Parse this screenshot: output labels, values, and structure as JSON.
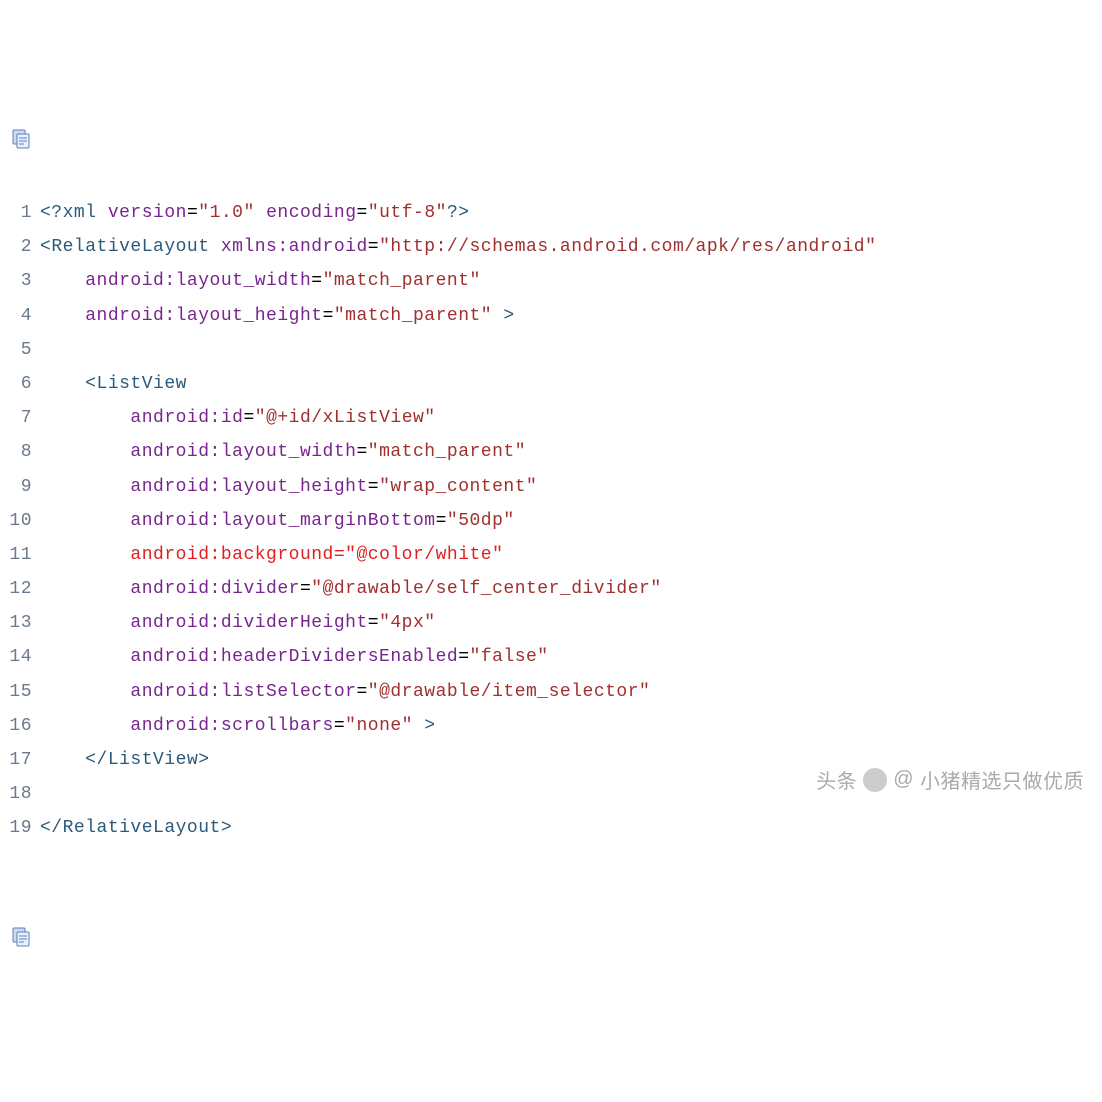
{
  "toolbar": {
    "copy_icon_color": "#5a7fbf",
    "copy_icon_color2": "#8fa8d8"
  },
  "code": {
    "lines": [
      {
        "n": "1",
        "segs": [
          {
            "t": "<?",
            "c": "c-prolog"
          },
          {
            "t": "xml ",
            "c": "c-prolog"
          },
          {
            "t": "version",
            "c": "c-attr"
          },
          {
            "t": "=",
            "c": "c-eq"
          },
          {
            "t": "\"1.0\"",
            "c": "c-str"
          },
          {
            "t": " ",
            "c": "c-plain"
          },
          {
            "t": "encoding",
            "c": "c-attr"
          },
          {
            "t": "=",
            "c": "c-eq"
          },
          {
            "t": "\"utf-8\"",
            "c": "c-str"
          },
          {
            "t": "?>",
            "c": "c-prolog"
          }
        ]
      },
      {
        "n": "2",
        "segs": [
          {
            "t": "<",
            "c": "c-punc"
          },
          {
            "t": "RelativeLayout ",
            "c": "c-tag"
          },
          {
            "t": "xmlns:android",
            "c": "c-attr"
          },
          {
            "t": "=",
            "c": "c-eq"
          },
          {
            "t": "\"http://schemas.android.com/apk/res/android\"",
            "c": "c-str"
          }
        ]
      },
      {
        "n": "3",
        "segs": [
          {
            "t": "    ",
            "c": "c-plain"
          },
          {
            "t": "android:layout_width",
            "c": "c-attr"
          },
          {
            "t": "=",
            "c": "c-eq"
          },
          {
            "t": "\"match_parent\"",
            "c": "c-str"
          }
        ]
      },
      {
        "n": "4",
        "segs": [
          {
            "t": "    ",
            "c": "c-plain"
          },
          {
            "t": "android:layout_height",
            "c": "c-attr"
          },
          {
            "t": "=",
            "c": "c-eq"
          },
          {
            "t": "\"match_parent\"",
            "c": "c-str"
          },
          {
            "t": " >",
            "c": "c-gt"
          }
        ]
      },
      {
        "n": "5",
        "segs": [
          {
            "t": "",
            "c": "c-plain"
          }
        ]
      },
      {
        "n": "6",
        "segs": [
          {
            "t": "    ",
            "c": "c-plain"
          },
          {
            "t": "<",
            "c": "c-punc"
          },
          {
            "t": "ListView",
            "c": "c-tag"
          }
        ]
      },
      {
        "n": "7",
        "segs": [
          {
            "t": "        ",
            "c": "c-plain"
          },
          {
            "t": "android:id",
            "c": "c-attr"
          },
          {
            "t": "=",
            "c": "c-eq"
          },
          {
            "t": "\"@+id/xListView\"",
            "c": "c-str"
          }
        ]
      },
      {
        "n": "8",
        "segs": [
          {
            "t": "        ",
            "c": "c-plain"
          },
          {
            "t": "android:layout_width",
            "c": "c-attr"
          },
          {
            "t": "=",
            "c": "c-eq"
          },
          {
            "t": "\"match_parent\"",
            "c": "c-str"
          }
        ]
      },
      {
        "n": "9",
        "segs": [
          {
            "t": "        ",
            "c": "c-plain"
          },
          {
            "t": "android:layout_height",
            "c": "c-attr"
          },
          {
            "t": "=",
            "c": "c-eq"
          },
          {
            "t": "\"wrap_content\"",
            "c": "c-str"
          }
        ]
      },
      {
        "n": "10",
        "segs": [
          {
            "t": "        ",
            "c": "c-plain"
          },
          {
            "t": "android:layout_marginBottom",
            "c": "c-attr"
          },
          {
            "t": "=",
            "c": "c-eq"
          },
          {
            "t": "\"50dp\"",
            "c": "c-str"
          }
        ]
      },
      {
        "n": "11",
        "segs": [
          {
            "t": "        ",
            "c": "c-plain"
          },
          {
            "t": "android:background",
            "c": "c-err"
          },
          {
            "t": "=",
            "c": "c-err"
          },
          {
            "t": "\"@color/white\"",
            "c": "c-err"
          }
        ]
      },
      {
        "n": "12",
        "segs": [
          {
            "t": "        ",
            "c": "c-plain"
          },
          {
            "t": "android:divider",
            "c": "c-attr"
          },
          {
            "t": "=",
            "c": "c-eq"
          },
          {
            "t": "\"@drawable/self_center_divider\"",
            "c": "c-str"
          }
        ]
      },
      {
        "n": "13",
        "segs": [
          {
            "t": "        ",
            "c": "c-plain"
          },
          {
            "t": "android:dividerHeight",
            "c": "c-attr"
          },
          {
            "t": "=",
            "c": "c-eq"
          },
          {
            "t": "\"4px\"",
            "c": "c-str"
          }
        ]
      },
      {
        "n": "14",
        "segs": [
          {
            "t": "        ",
            "c": "c-plain"
          },
          {
            "t": "android:headerDividersEnabled",
            "c": "c-attr"
          },
          {
            "t": "=",
            "c": "c-eq"
          },
          {
            "t": "\"false\"",
            "c": "c-str"
          }
        ]
      },
      {
        "n": "15",
        "segs": [
          {
            "t": "        ",
            "c": "c-plain"
          },
          {
            "t": "android:listSelector",
            "c": "c-attr"
          },
          {
            "t": "=",
            "c": "c-eq"
          },
          {
            "t": "\"@drawable/item_selector\"",
            "c": "c-str"
          }
        ]
      },
      {
        "n": "16",
        "segs": [
          {
            "t": "        ",
            "c": "c-plain"
          },
          {
            "t": "android:scrollbars",
            "c": "c-attr"
          },
          {
            "t": "=",
            "c": "c-eq"
          },
          {
            "t": "\"none\"",
            "c": "c-str"
          },
          {
            "t": " >",
            "c": "c-gt"
          }
        ]
      },
      {
        "n": "17",
        "segs": [
          {
            "t": "    ",
            "c": "c-plain"
          },
          {
            "t": "</",
            "c": "c-punc"
          },
          {
            "t": "ListView",
            "c": "c-tag"
          },
          {
            "t": ">",
            "c": "c-punc"
          }
        ]
      },
      {
        "n": "18",
        "segs": [
          {
            "t": "",
            "c": "c-plain"
          }
        ]
      },
      {
        "n": "19",
        "segs": [
          {
            "t": "</",
            "c": "c-punc"
          },
          {
            "t": "RelativeLayout",
            "c": "c-tag"
          },
          {
            "t": ">",
            "c": "c-punc"
          }
        ]
      }
    ]
  },
  "watermark": {
    "prefix": "头条",
    "at": "@",
    "name": "小猪精选只做优质"
  }
}
